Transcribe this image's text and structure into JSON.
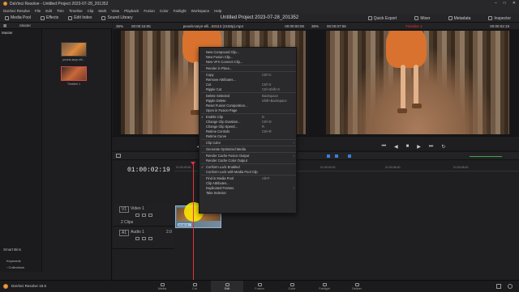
{
  "window": {
    "title": "DaVinci Resolve - Untitled Project 2023-07-28_201352"
  },
  "menu_bar": [
    "DaVinci Resolve",
    "File",
    "Edit",
    "Trim",
    "Timeline",
    "Clip",
    "Mark",
    "View",
    "Playback",
    "Fusion",
    "Color",
    "Fairlight",
    "Workspace",
    "Help"
  ],
  "toolbar": {
    "media_pool": "Media Pool",
    "effects": "Effects",
    "edit_index": "Edit Index",
    "sound_library": "Sound Library",
    "project_title": "Untitled Project 2023-07-28_201352",
    "quick_export": "Quick Export",
    "mixer": "Mixer",
    "metadata": "Metadata",
    "inspector": "Inspector"
  },
  "left_panel": {
    "master_bin": "Master",
    "master_header": "Master",
    "clip1_caption": "pexels-taryn-elli...",
    "clip2_caption": "Timeline 1",
    "smart_bins": "Smart Bins",
    "keywords": "Keywords",
    "collections": "Collections"
  },
  "source_viewer": {
    "zoom": "36%",
    "timecode": "00:00:15:05",
    "clip_name": "pexels-taryn-elli...83113 (2160p).mp4",
    "duration": "00:00:00:00"
  },
  "timeline_viewer": {
    "zoom": "36%",
    "timecode": "00:00:07:06",
    "timeline_name": "Timeline 1",
    "current": "00:00:02:19"
  },
  "timeline": {
    "timecode": "01:00:02:19",
    "ruler": [
      "01:00:00:00",
      "01:00:02:00",
      "01:00:04:00",
      "01:00:06:00",
      "01:00:08:00"
    ],
    "video_track": "V1",
    "video_name": "Video 1",
    "clips_count": "2 Clips",
    "audio_track": "A1",
    "audio_name": "Audio 1",
    "audio_level": "2.0",
    "clip_label": "pexels-ta..."
  },
  "context_menu": [
    {
      "label": "New Compound Clip...",
      "shortcut": ""
    },
    {
      "label": "New Fusion Clip...",
      "shortcut": ""
    },
    {
      "label": "New VFX Connect Clip...",
      "shortcut": ""
    },
    {
      "sep": true
    },
    {
      "label": "Render in Place...",
      "shortcut": ""
    },
    {
      "sep": true
    },
    {
      "label": "Copy",
      "shortcut": "Ctrl+C"
    },
    {
      "label": "Remove Attributes...",
      "shortcut": ""
    },
    {
      "label": "Cut",
      "shortcut": "Ctrl+X"
    },
    {
      "label": "Ripple Cut",
      "shortcut": "Ctrl+Shift+X"
    },
    {
      "sep": true
    },
    {
      "label": "Delete Selected",
      "shortcut": "Backspace"
    },
    {
      "label": "Ripple Delete",
      "shortcut": "Shift+Backspace"
    },
    {
      "label": "Reset Fusion Composition...",
      "shortcut": ""
    },
    {
      "label": "Open in Fusion Page",
      "shortcut": ""
    },
    {
      "sep": true
    },
    {
      "label": "Enable Clip",
      "shortcut": "D",
      "check": true
    },
    {
      "label": "Change Clip Duration...",
      "shortcut": "Ctrl+D"
    },
    {
      "label": "Change Clip Speed...",
      "shortcut": "R"
    },
    {
      "label": "Retime Controls",
      "shortcut": "Ctrl+R"
    },
    {
      "label": "Retime Curve",
      "shortcut": ""
    },
    {
      "sep": true
    },
    {
      "label": "Clip Color",
      "shortcut": "",
      "arrow": true
    },
    {
      "sep": true
    },
    {
      "label": "Generate Optimized Media",
      "shortcut": ""
    },
    {
      "sep": true
    },
    {
      "label": "Render Cache Fusion Output",
      "shortcut": "",
      "arrow": true
    },
    {
      "label": "Render Cache Color Output",
      "shortcut": ""
    },
    {
      "sep": true
    },
    {
      "label": "Conform Lock Enabled",
      "shortcut": "",
      "check": true
    },
    {
      "label": "Conform Lock with Media Pool Clip",
      "shortcut": ""
    },
    {
      "sep": true
    },
    {
      "label": "Find in Media Pool",
      "shortcut": "Alt+F"
    },
    {
      "label": "Clip Attributes...",
      "shortcut": ""
    },
    {
      "label": "Duplicated Frames",
      "shortcut": "",
      "arrow": true
    },
    {
      "label": "Take Selector",
      "shortcut": ""
    }
  ],
  "app_footer": {
    "name": "DaVinci Resolve 18.5"
  },
  "page_tabs": [
    "Media",
    "Cut",
    "Edit",
    "Fusion",
    "Color",
    "Fairlight",
    "Deliver"
  ]
}
